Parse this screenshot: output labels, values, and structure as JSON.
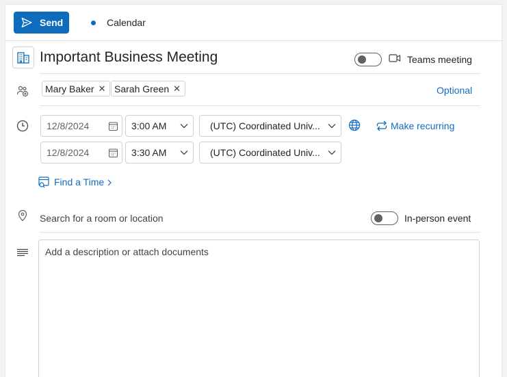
{
  "toolbar": {
    "send_label": "Send",
    "calendar_label": "Calendar"
  },
  "event": {
    "title": "Important Business Meeting",
    "teams_label": "Teams meeting",
    "teams_enabled": false
  },
  "attendees": {
    "people": [
      "Mary Baker",
      "Sarah Green"
    ],
    "optional_label": "Optional"
  },
  "time": {
    "start_date": "12/8/2024",
    "start_time": "3:00 AM",
    "end_date": "12/8/2024",
    "end_time": "3:30 AM",
    "timezone": "(UTC) Coordinated Univ...",
    "recurring_label": "Make recurring",
    "find_time_label": "Find a Time"
  },
  "location": {
    "placeholder": "Search for a room or location",
    "in_person_label": "In-person event",
    "in_person_enabled": false
  },
  "description": {
    "placeholder": "Add a description or attach documents"
  },
  "colors": {
    "accent": "#0f6cbd"
  }
}
